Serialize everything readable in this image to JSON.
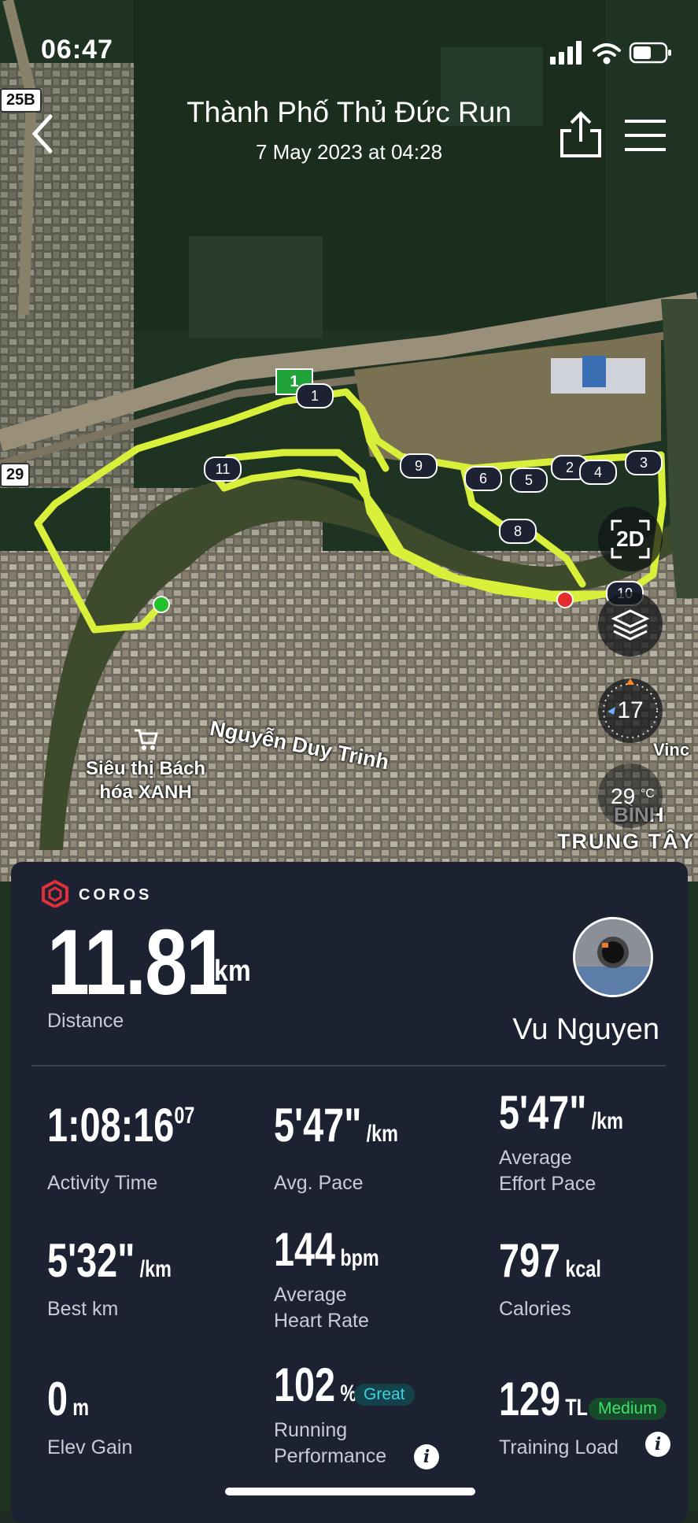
{
  "status": {
    "time": "06:47"
  },
  "header": {
    "title": "Thành Phố Thủ Đức Run",
    "date": "7 May 2023 at 04:28"
  },
  "map": {
    "road_labels": [
      "25B",
      "29"
    ],
    "street": "Nguyễn Duy Trinh",
    "poi": "Siêu thị Bách hóa XANH",
    "area_line1": "BÌNH",
    "area_line2": "TRUNG TÂY",
    "edge_label": "Vinc",
    "start_flag": "1",
    "km_markers": [
      "1",
      "2",
      "3",
      "4",
      "5",
      "6",
      "8",
      "9",
      "10",
      "11"
    ],
    "view_toggle": "2D",
    "compass": "17",
    "temperature": "29",
    "temperature_unit": "°C",
    "route_color": "#d8f03a"
  },
  "summary": {
    "brand": "COROS",
    "distance": "11.81",
    "distance_unit": "km",
    "distance_label": "Distance",
    "athlete": "Vu Nguyen",
    "stats": {
      "activity_time": {
        "value": "1:08:16",
        "sup": "07",
        "label": "Activity Time"
      },
      "avg_pace": {
        "value": "5'47\"",
        "unit": "/km",
        "label": "Avg. Pace"
      },
      "effort_pace": {
        "value": "5'47\"",
        "unit": "/km",
        "label_line1": "Average",
        "label_line2": "Effort Pace"
      },
      "best_km": {
        "value": "5'32\"",
        "unit": "/km",
        "label": "Best km"
      },
      "heart_rate": {
        "value": "144",
        "unit": "bpm",
        "label_line1": "Average",
        "label_line2": "Heart Rate"
      },
      "calories": {
        "value": "797",
        "unit": "kcal",
        "label": "Calories"
      },
      "elev_gain": {
        "value": "0",
        "unit": "m",
        "label": "Elev Gain"
      },
      "running_performance": {
        "value": "102",
        "unit": "%",
        "badge": "Great",
        "label_line1": "Running",
        "label_line2": "Performance"
      },
      "training_load": {
        "value": "129",
        "unit": "TL",
        "badge": "Medium",
        "label": "Training Load"
      }
    }
  }
}
